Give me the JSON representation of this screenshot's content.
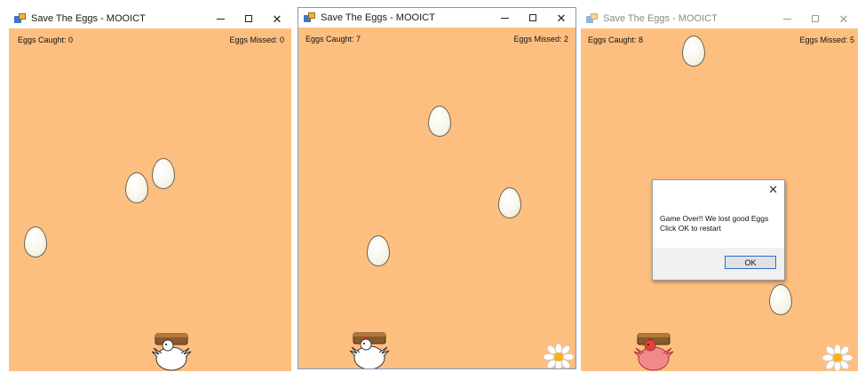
{
  "windows": [
    {
      "title": "Save The Eggs - MOOICT",
      "eggs_caught": "Eggs Caught: 0",
      "eggs_missed": "Eggs Missed: 0",
      "controls": {
        "minimize": "minimize-icon",
        "maximize": "maximize-icon",
        "close": "close-icon"
      }
    },
    {
      "title": "Save The Eggs - MOOICT",
      "eggs_caught": "Eggs Caught: 7",
      "eggs_missed": "Eggs Missed: 2",
      "controls": {
        "minimize": "minimize-icon",
        "maximize": "maximize-icon",
        "close": "close-icon"
      }
    },
    {
      "title": "Save The Eggs - MOOICT",
      "eggs_caught": "Eggs Caught: 8",
      "eggs_missed": "Eggs Missed: 5",
      "controls": {
        "minimize": "minimize-icon",
        "maximize": "maximize-icon",
        "close": "close-icon"
      },
      "dialog": {
        "line1": "Game Over!! We lost good Eggs",
        "line2": "Click OK to restart",
        "ok_label": "OK"
      }
    }
  ],
  "colors": {
    "play_area": "#fdbf80",
    "egg_outline": "#6d6350",
    "chicken_white": "#ffffff",
    "chicken_hit": "#f08a8a",
    "basket": "#8a5a2b",
    "ok_border": "#2b6fd6"
  }
}
